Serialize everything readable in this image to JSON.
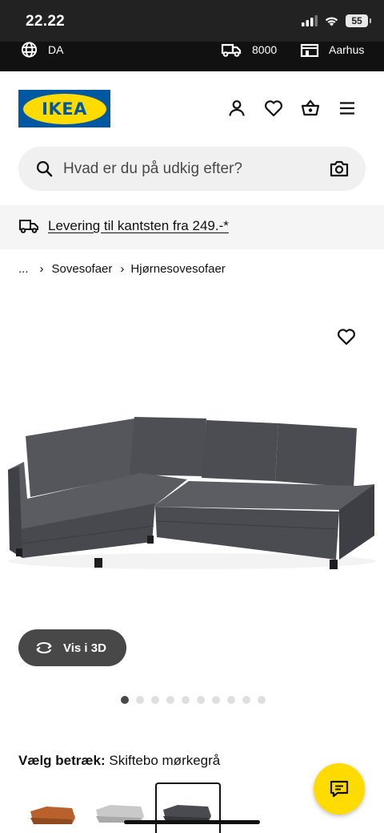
{
  "status_bar": {
    "time": "22.22",
    "battery": "55"
  },
  "top_strip": {
    "language": "DA",
    "postcode": "8000",
    "store": "Aarhus"
  },
  "header": {
    "logo_text": "IKEA",
    "icons": [
      "user-icon",
      "heart-icon",
      "basket-icon",
      "menu-icon"
    ]
  },
  "search": {
    "placeholder": "Hvad er du på udkig efter?"
  },
  "delivery_banner": {
    "text": "Levering til kantsten fra 249.-*"
  },
  "breadcrumb": {
    "ellipsis": "...",
    "items": [
      "Sovesofaer",
      "Hjørnesovesofaer"
    ]
  },
  "product": {
    "view_3d_label": "Vis i 3D",
    "image_count": 10,
    "active_image": 1
  },
  "fabric": {
    "label": "Vælg betræk:",
    "value": "Skiftebo mørkegrå"
  },
  "colors": {
    "ikea_blue": "#0058a3",
    "ikea_yellow": "#ffdb00",
    "dark_button": "#484848",
    "swatches": [
      "#b8612c",
      "#c9c9c9",
      "#4a4b50"
    ]
  }
}
